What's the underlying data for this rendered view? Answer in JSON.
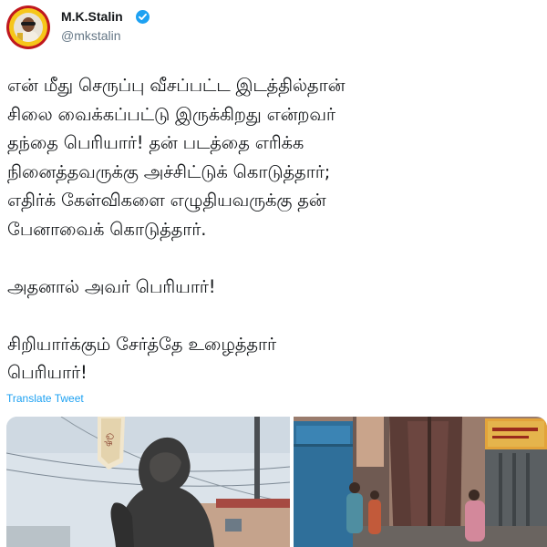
{
  "author": {
    "name": "M.K.Stalin",
    "handle": "@mkstalin",
    "verified": true,
    "avatar_icon": "profile-avatar"
  },
  "tweet": {
    "paragraphs": [
      [
        "என் மீது செருப்பு வீசப்பட்ட இடத்தில்தான்",
        "சிலை வைக்கப்பட்டு இருக்கிறது என்றவர்",
        "தந்தை பெரியார்! தன் படத்தை எரிக்க",
        "நினைத்தவருக்கு அச்சிட்டுக் கொடுத்தார்;",
        "எதிர்க் கேள்விகளை எழுதியவருக்கு தன்",
        "பேனாவைக் கொடுத்தார்."
      ],
      [
        "அதனால் அவர் பெரியார்!"
      ],
      [
        "சிறியார்க்கும் சேர்த்தே உழைத்தார்",
        "பெரியார்!"
      ]
    ],
    "translate_label": "Translate Tweet"
  },
  "media": {
    "images": [
      "statue-photo",
      "street-photo"
    ]
  },
  "colors": {
    "link": "#1da1f2",
    "text": "#14171a",
    "secondary": "#657786"
  }
}
